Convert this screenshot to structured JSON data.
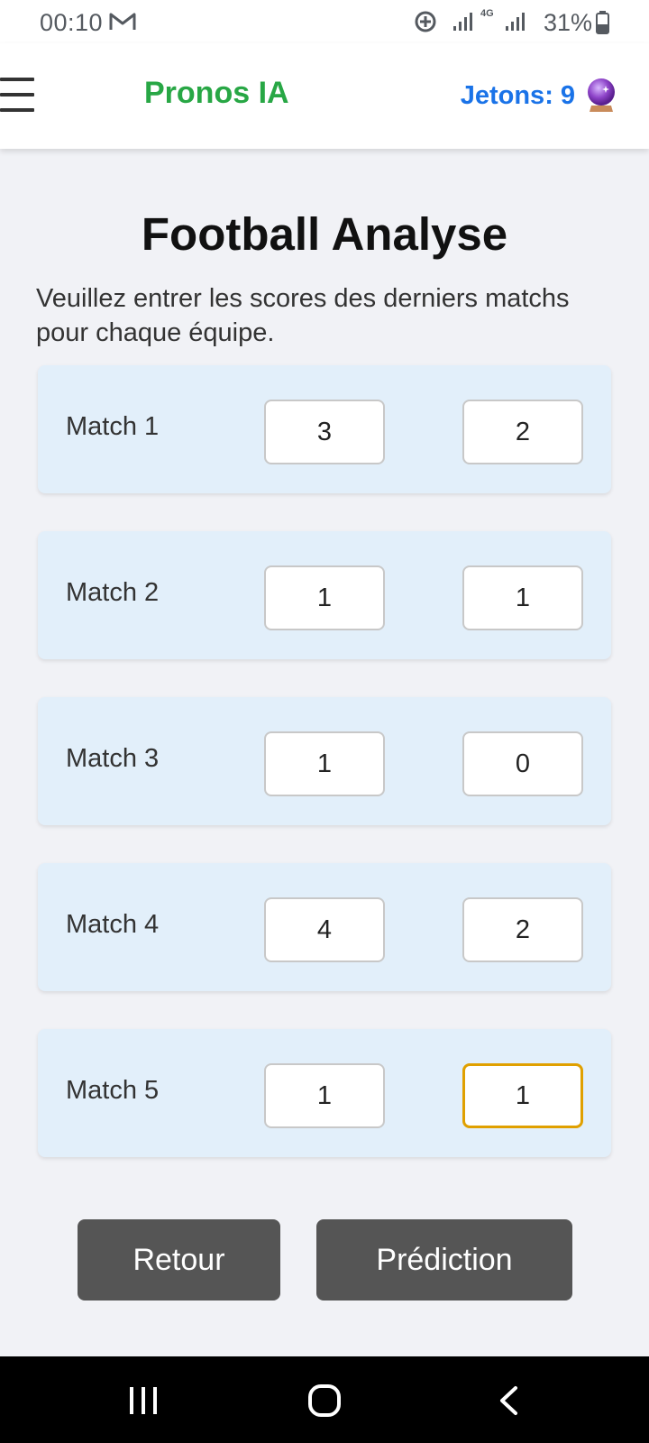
{
  "status_bar": {
    "time": "00:10",
    "network": "4G",
    "battery": "31%",
    "icons": [
      "mail-icon",
      "sync-icon",
      "signal-icon",
      "battery-icon"
    ]
  },
  "header": {
    "app_title": "Pronos IA",
    "tokens_label": "Jetons:",
    "tokens_count": "9",
    "icons": [
      "menu-icon",
      "crystal-ball-icon"
    ]
  },
  "main": {
    "title": "Football Analyse",
    "instructions": "Veuillez entrer les scores des derniers matchs pour chaque équipe.",
    "matches": [
      {
        "label": "Match 1",
        "home": "3",
        "away": "2"
      },
      {
        "label": "Match 2",
        "home": "1",
        "away": "1"
      },
      {
        "label": "Match 3",
        "home": "1",
        "away": "0"
      },
      {
        "label": "Match 4",
        "home": "4",
        "away": "2"
      },
      {
        "label": "Match 5",
        "home": "1",
        "away": "1"
      }
    ],
    "buttons": {
      "back": "Retour",
      "predict": "Prédiction"
    }
  },
  "colors": {
    "title_green": "#28a745",
    "tokens_blue": "#1a73e8",
    "card_bg": "#e2effa",
    "focus_border": "#e0a000",
    "button_bg": "#555555"
  }
}
